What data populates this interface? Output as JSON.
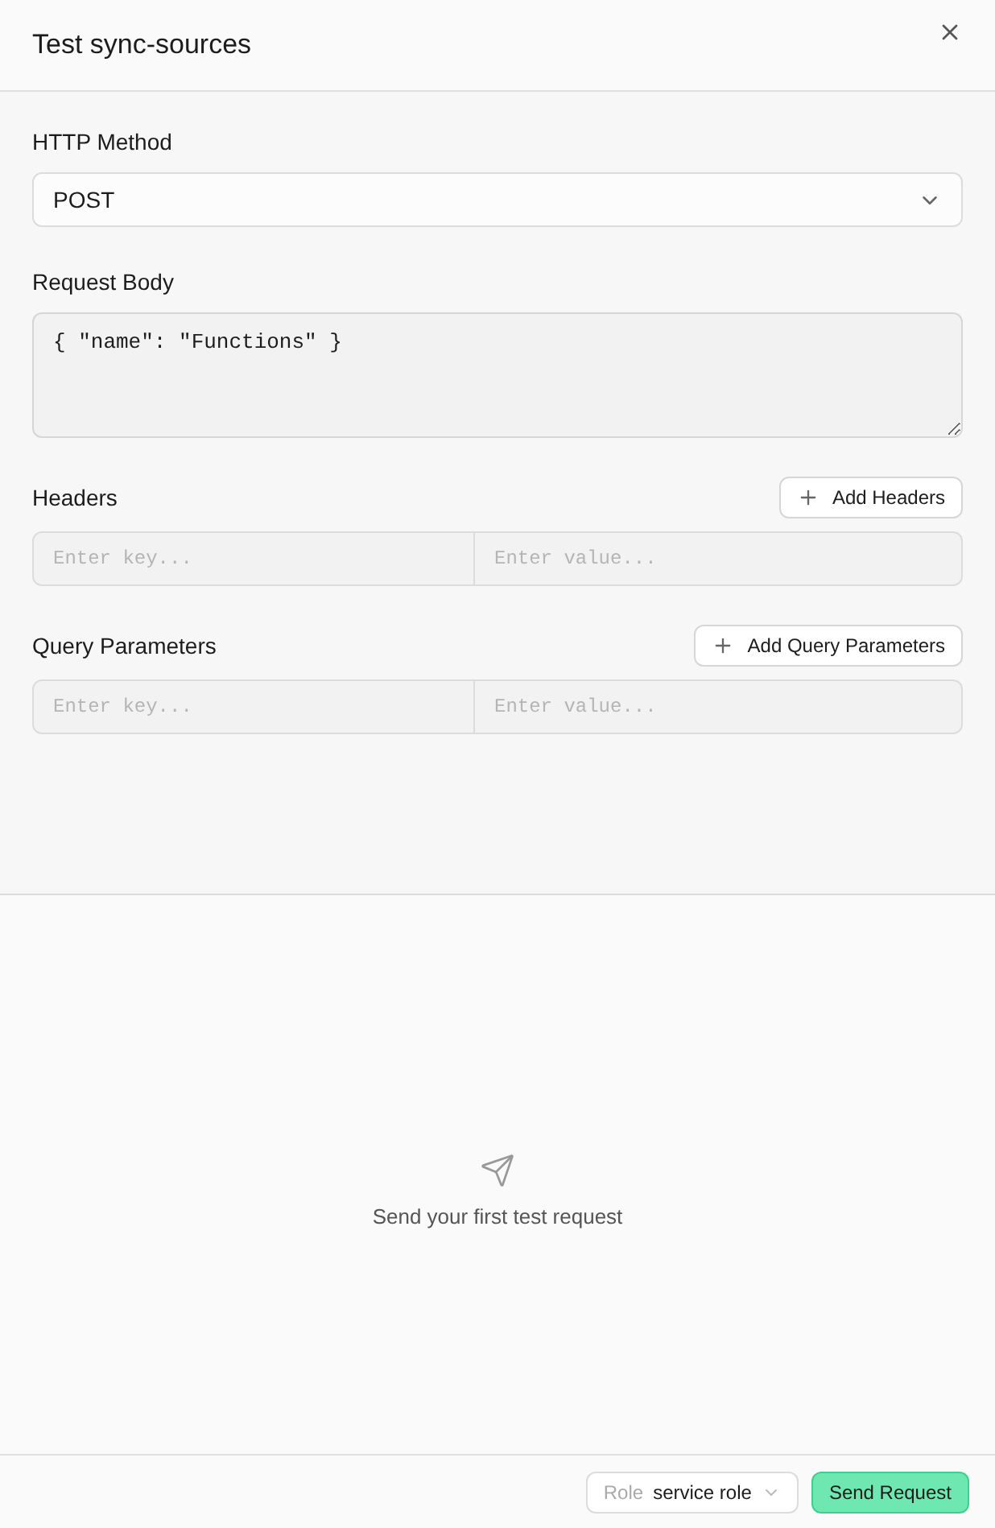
{
  "dialog": {
    "title": "Test sync-sources"
  },
  "method": {
    "label": "HTTP Method",
    "value": "POST"
  },
  "body": {
    "label": "Request Body",
    "value": "{ \"name\": \"Functions\" }"
  },
  "sections": [
    {
      "label": "Headers",
      "button": "Add Headers",
      "key_placeholder": "Enter key...",
      "value_placeholder": "Enter value..."
    },
    {
      "label": "Query Parameters",
      "button": "Add Query Parameters",
      "key_placeholder": "Enter key...",
      "value_placeholder": "Enter value..."
    }
  ],
  "empty_state": {
    "message": "Send your first test request"
  },
  "footer": {
    "role_label": "Role",
    "role_value": "service role",
    "send": "Send Request"
  }
}
